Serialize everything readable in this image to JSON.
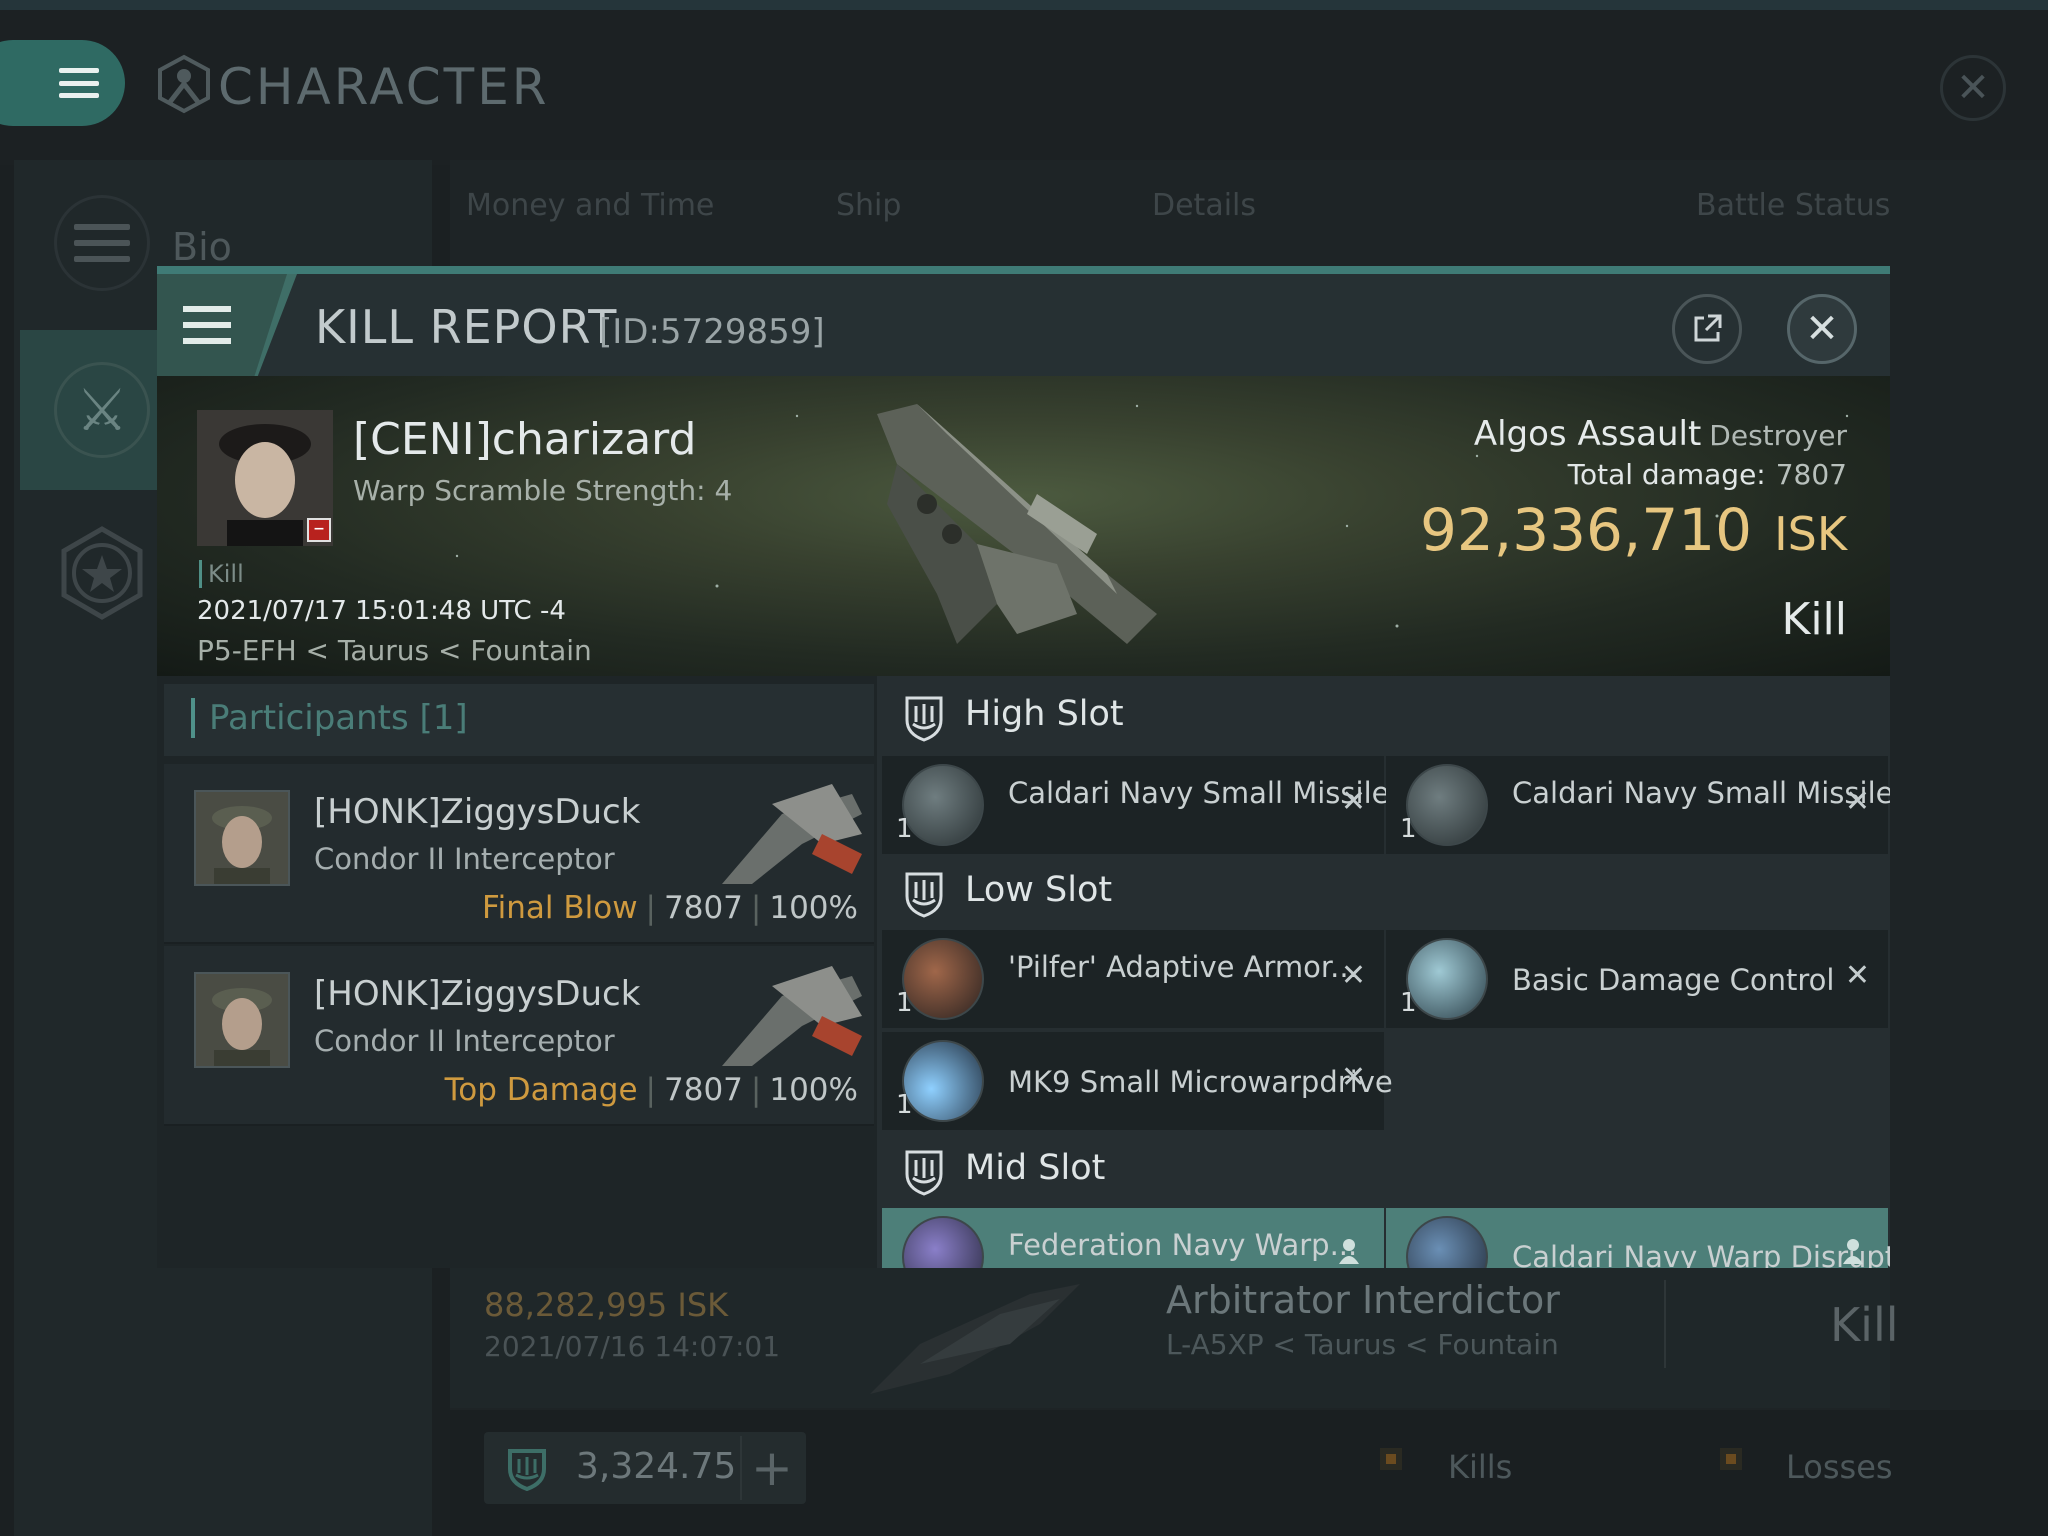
{
  "window": {
    "title": "CHARACTER",
    "sidebar": {
      "bio_label": "Bio"
    },
    "tabs": [
      "Money and Time",
      "Ship",
      "Details",
      "Battle Status"
    ]
  },
  "background_row": {
    "isk": "88,282,995  ISK",
    "date": "2021/07/16  14:07:01",
    "ship": "Arbitrator Interdictor",
    "location": "L-A5XP < Taurus < Fountain",
    "type": "Kill"
  },
  "footer": {
    "skill_value": "3,324.75",
    "plus_label": "+",
    "legend_kills": "Kills",
    "legend_losses": "Losses"
  },
  "kill_report": {
    "title": "KILL REPORT",
    "id_label": "[ID:5729859]",
    "victim": {
      "name": "[CENI]charizard",
      "warp_scramble": "Warp Scramble Strength: 4",
      "kill_tag": "Kill",
      "datetime": "2021/07/17 15:01:48 UTC -4",
      "location": "P5-EFH < Taurus < Fountain",
      "badge": "–"
    },
    "summary": {
      "ship_name": "Algos Assault",
      "ship_class": "Destroyer",
      "total_damage_label": "Total damage:",
      "total_damage_value": "7807",
      "isk_value": "92,336,710",
      "isk_unit": "ISK",
      "type": "Kill"
    },
    "participants": {
      "title": "Participants [1]",
      "rows": [
        {
          "name": "[HONK]ZiggysDuck",
          "ship": "Condor II Interceptor",
          "role": "Final Blow",
          "damage": "7807",
          "percent": "100%"
        },
        {
          "name": "[HONK]ZiggysDuck",
          "ship": "Condor II Interceptor",
          "role": "Top Damage",
          "damage": "7807",
          "percent": "100%"
        }
      ]
    },
    "fitting": {
      "high_slot_label": "High Slot",
      "low_slot_label": "Low Slot",
      "mid_slot_label": "Mid Slot",
      "high": [
        {
          "name": "Caldari Navy Small Missile...",
          "qty": "1"
        },
        {
          "name": "Caldari Navy Small Missile...",
          "qty": "1"
        }
      ],
      "low": [
        {
          "name": "'Pilfer' Adaptive Armor...",
          "qty": "1"
        },
        {
          "name": "Basic Damage Control",
          "qty": "1"
        },
        {
          "name": "MK9 Small Microwarpdrive",
          "qty": "1"
        }
      ],
      "mid": [
        {
          "name": "Federation Navy Warp..."
        },
        {
          "name": "Caldari Navy Warp Disruptor"
        }
      ]
    }
  }
}
